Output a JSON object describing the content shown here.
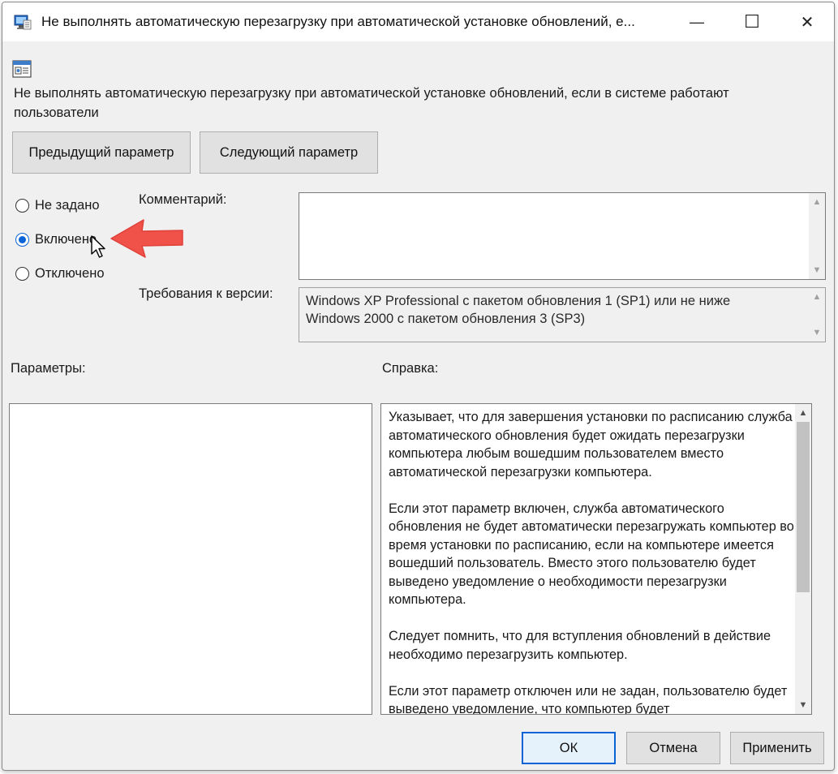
{
  "window": {
    "title": "Не выполнять автоматическую перезагрузку при автоматической установке обновлений, е...",
    "minimize_glyph": "—",
    "maximize_glyph": "☐",
    "close_glyph": "✕"
  },
  "policy": {
    "name": "Не выполнять автоматическую перезагрузку при автоматической установке обновлений, если в системе работают пользователи",
    "icon": "policy-setting-icon"
  },
  "nav": {
    "prev_label": "Предыдущий параметр",
    "next_label": "Следующий параметр"
  },
  "state": {
    "options": [
      {
        "label": "Не задано",
        "checked": false
      },
      {
        "label": "Включено",
        "checked": true
      },
      {
        "label": "Отключено",
        "checked": false
      }
    ]
  },
  "comment": {
    "label": "Комментарий:",
    "value": ""
  },
  "version": {
    "label": "Требования к версии:",
    "line1": "Windows XP Professional с пакетом обновления 1 (SP1) или не ниже",
    "line2": "Windows 2000 с пакетом обновления 3 (SP3)"
  },
  "params": {
    "label": "Параметры:"
  },
  "help": {
    "label": "Справка:",
    "paragraphs": [
      "Указывает, что для завершения установки по расписанию служба автоматического обновления будет ожидать перезагрузки компьютера любым вошедшим пользователем вместо автоматической перезагрузки компьютера.",
      "Если этот параметр включен, служба автоматического обновления не будет автоматически перезагружать компьютер во время установки по расписанию, если на компьютере имеется вошедший пользователь. Вместо этого пользователю будет выведено уведомление о необходимости перезагрузки компьютера.",
      "Следует помнить, что для вступления обновлений в действие необходимо перезагрузить компьютер.",
      "Если этот параметр отключен или не задан, пользователю будет выведено уведомление, что компьютер будет"
    ]
  },
  "footer": {
    "ok_label": "ОК",
    "cancel_label": "Отмена",
    "apply_label": "Применить"
  },
  "colors": {
    "accent": "#0a64d8",
    "annotation_arrow": "#f0524a"
  }
}
